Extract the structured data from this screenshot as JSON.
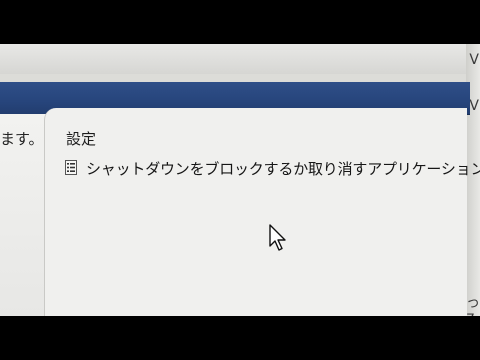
{
  "window": {
    "left_text": "ます。",
    "heading": "設定"
  },
  "settings_list": {
    "items": [
      {
        "label": "シャットダウンをブロックするか取り消すアプリケーションの自動",
        "icon": "list-icon"
      }
    ]
  },
  "edge_glyphs": [
    "V",
    "V",
    "っ7"
  ],
  "colors": {
    "title_bar": "#27457c",
    "background": "#f0f0ee",
    "text": "#161616"
  }
}
